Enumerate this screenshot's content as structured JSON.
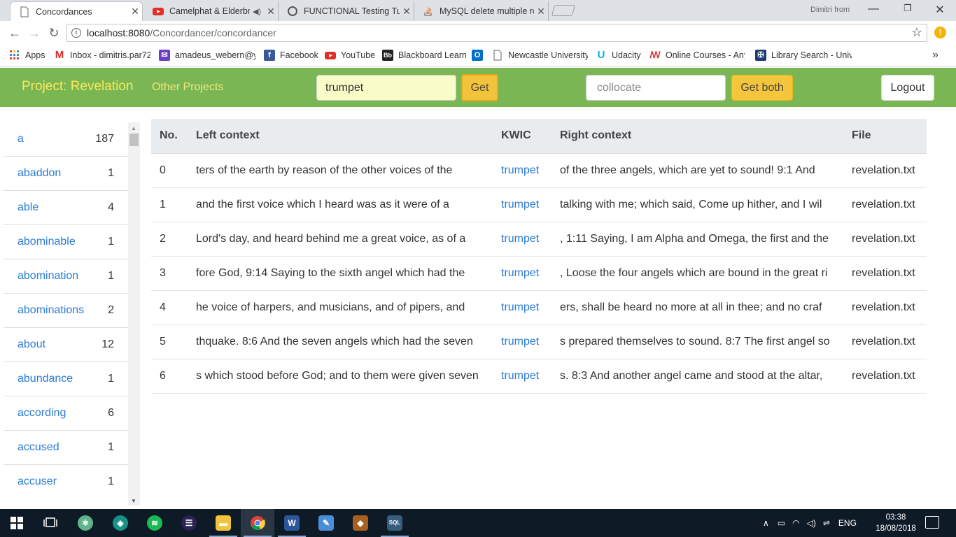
{
  "browser": {
    "tabs": [
      {
        "title": "Concordances",
        "active": true,
        "icon": "document-icon"
      },
      {
        "title": "Camelphat & Elderbrook",
        "active": false,
        "icon": "youtube-icon",
        "audio": true
      },
      {
        "title": "FUNCTIONAL Testing Tut",
        "active": false,
        "icon": "guru99-icon"
      },
      {
        "title": "MySQL delete multiple rc",
        "active": false,
        "icon": "stackoverflow-icon"
      }
    ],
    "user_name": "Dimitri from",
    "url": {
      "host": "localhost:8080",
      "path": "/Concordancer/concordancer"
    },
    "bookmarks": [
      {
        "label": "Apps",
        "icon": "apps-icon"
      },
      {
        "label": "Inbox - dimitris.par72",
        "icon": "gmail-icon"
      },
      {
        "label": "amadeus_webern@y",
        "icon": "yahoo-mail-icon"
      },
      {
        "label": "Facebook",
        "icon": "facebook-icon"
      },
      {
        "label": "YouTube",
        "icon": "youtube-icon"
      },
      {
        "label": "Blackboard Learn",
        "icon": "blackboard-icon"
      },
      {
        "label": "",
        "icon": "outlook-icon"
      },
      {
        "label": "Newcastle University",
        "icon": "page-icon"
      },
      {
        "label": "Udacity",
        "icon": "udacity-icon"
      },
      {
        "label": "Online Courses - Any",
        "icon": "online-courses-icon"
      },
      {
        "label": "Library Search - Univ",
        "icon": "university-crest-icon"
      }
    ],
    "bookmarks_more": "»"
  },
  "app": {
    "brand": "Project: Revelation",
    "other_projects": "Other Projects",
    "search_value": "trumpet",
    "get_label": "Get",
    "collocate_placeholder": "collocate",
    "get_both_label": "Get both",
    "logout_label": "Logout",
    "accent_color": "#7ab754",
    "button_color": "#f5c53b"
  },
  "words": [
    {
      "word": "a",
      "count": "187"
    },
    {
      "word": "abaddon",
      "count": "1"
    },
    {
      "word": "able",
      "count": "4"
    },
    {
      "word": "abominable",
      "count": "1"
    },
    {
      "word": "abomination",
      "count": "1"
    },
    {
      "word": "abominations",
      "count": "2"
    },
    {
      "word": "about",
      "count": "12"
    },
    {
      "word": "abundance",
      "count": "1"
    },
    {
      "word": "according",
      "count": "6"
    },
    {
      "word": "accused",
      "count": "1"
    },
    {
      "word": "accuser",
      "count": "1"
    }
  ],
  "table": {
    "headers": {
      "no": "No.",
      "left": "Left context",
      "kwic": "KWIC",
      "right": "Right context",
      "file": "File"
    },
    "rows": [
      {
        "no": "0",
        "left": "ters of the earth by reason of the other voices of the",
        "kwic": "trumpet",
        "right": "of the three angels, which are yet to sound! 9:1 And",
        "file": "revelation.txt"
      },
      {
        "no": "1",
        "left": "and the first voice which I heard was as it were of a",
        "kwic": "trumpet",
        "right": "talking with me; which said, Come up hither, and I wil",
        "file": "revelation.txt"
      },
      {
        "no": "2",
        "left": "Lord's day, and heard behind me a great voice, as of a",
        "kwic": "trumpet",
        "right": ", 1:11 Saying, I am Alpha and Omega, the first and the",
        "file": "revelation.txt"
      },
      {
        "no": "3",
        "left": "fore God, 9:14 Saying to the sixth angel which had the",
        "kwic": "trumpet",
        "right": ", Loose the four angels which are bound in the great ri",
        "file": "revelation.txt"
      },
      {
        "no": "4",
        "left": "he voice of harpers, and musicians, and of pipers, and",
        "kwic": "trumpet",
        "right": "ers, shall be heard no more at all in thee; and no craf",
        "file": "revelation.txt"
      },
      {
        "no": "5",
        "left": "thquake. 8:6 And the seven angels which had the seven",
        "kwic": "trumpet",
        "right": "s prepared themselves to sound. 8:7 The first angel so",
        "file": "revelation.txt"
      },
      {
        "no": "6",
        "left": "s which stood before God; and to them were given seven",
        "kwic": "trumpet",
        "right": "s. 8:3 And another angel came and stood at the altar,",
        "file": "revelation.txt"
      }
    ]
  },
  "taskbar": {
    "apps": [
      "windows-start-icon",
      "task-view-icon",
      "atom-icon",
      "gitkraken-icon",
      "spotify-icon",
      "eclipse-icon",
      "file-explorer-icon",
      "chrome-icon",
      "word-icon",
      "paint-icon",
      "game-icon",
      "mysql-workbench-icon"
    ],
    "language": "ENG",
    "time": "03:38",
    "date": "18/08/2018"
  }
}
